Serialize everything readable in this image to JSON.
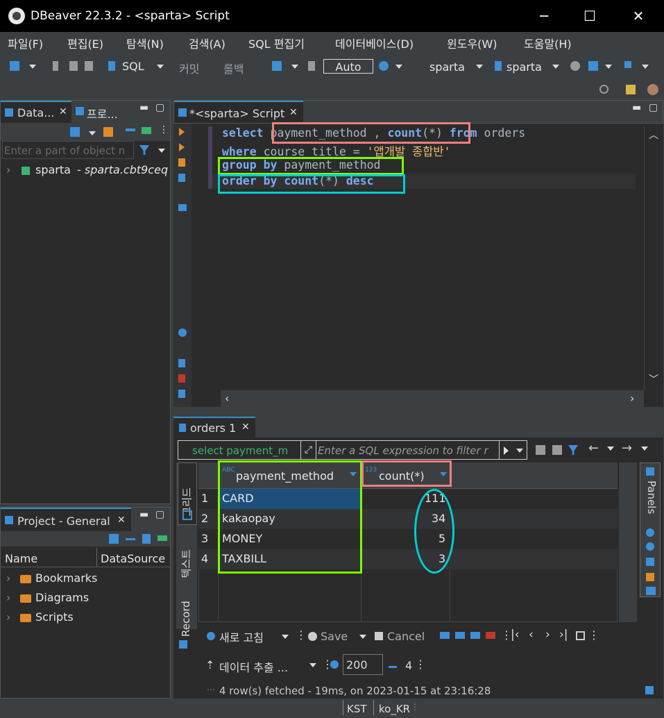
{
  "window": {
    "title": "DBeaver 22.3.2 - <sparta> Script",
    "minimize": "─",
    "maximize": "☐",
    "close": "✕"
  },
  "menu": [
    "파일(F)",
    "편집(E)",
    "탐색(N)",
    "검색(A)",
    "SQL 편집기",
    "데이터베이스(D)",
    "윈도우(W)",
    "도움말(H)"
  ],
  "toolbar": {
    "sql": "SQL",
    "commit": "커밋",
    "rollback": "롤백",
    "auto": "Auto",
    "datasource": "sparta",
    "schema": "sparta"
  },
  "navigator": {
    "tab_db": "Data...",
    "tab_proj": "프로...",
    "filter_placeholder": "Enter a part of object n",
    "conn_name": "sparta",
    "conn_host": "- sparta.cbt9ceq"
  },
  "project": {
    "tab": "Project - General",
    "col_name": "Name",
    "col_ds": "DataSource",
    "items": [
      "Bookmarks",
      "Diagrams",
      "Scripts"
    ]
  },
  "editor": {
    "tab": "*<sparta> Script",
    "line1": {
      "k1": "select",
      "a": "payment_method , ",
      "f": "count",
      "b": "(*)",
      "k2": "from",
      "c": "orders"
    },
    "line2": {
      "k1": "where",
      "a": "course_title = ",
      "s": "'앱개발 종합반'"
    },
    "line3": {
      "k1": "group by",
      "a": "payment_method"
    },
    "line4": {
      "k1": "order by",
      "f": "count",
      "b": "(*)",
      "k2": "desc"
    }
  },
  "results": {
    "tab": "orders 1",
    "sql_preview": "select payment_m",
    "filter_placeholder": "Enter a SQL expression to filter r",
    "col1": "payment_method",
    "col2": "count(*)",
    "col2_type": "123",
    "col1_type": "ABC",
    "rows": [
      {
        "n": "1",
        "method": "CARD",
        "count": "111"
      },
      {
        "n": "2",
        "method": "kakaopay",
        "count": "34"
      },
      {
        "n": "3",
        "method": "MONEY",
        "count": "5"
      },
      {
        "n": "4",
        "method": "TAXBILL",
        "count": "3"
      }
    ],
    "side_grid": "그리드",
    "side_text": "텍스트",
    "side_record": "Record",
    "panels": "Panels",
    "refresh": "새로 고침",
    "save": "Save",
    "cancel": "Cancel",
    "export": "데이터 추출 ...",
    "fetch_size": "200",
    "row_count": "4",
    "status": "4 row(s) fetched - 19ms, on 2023-01-15 at 23:16:28"
  },
  "statusbar": {
    "tz": "KST",
    "locale": "ko_KR"
  },
  "colors": {
    "highlight_red": "#f08080",
    "highlight_green": "#7cfc00",
    "highlight_cyan": "#00ced1",
    "selection": "#1d4f7a"
  }
}
